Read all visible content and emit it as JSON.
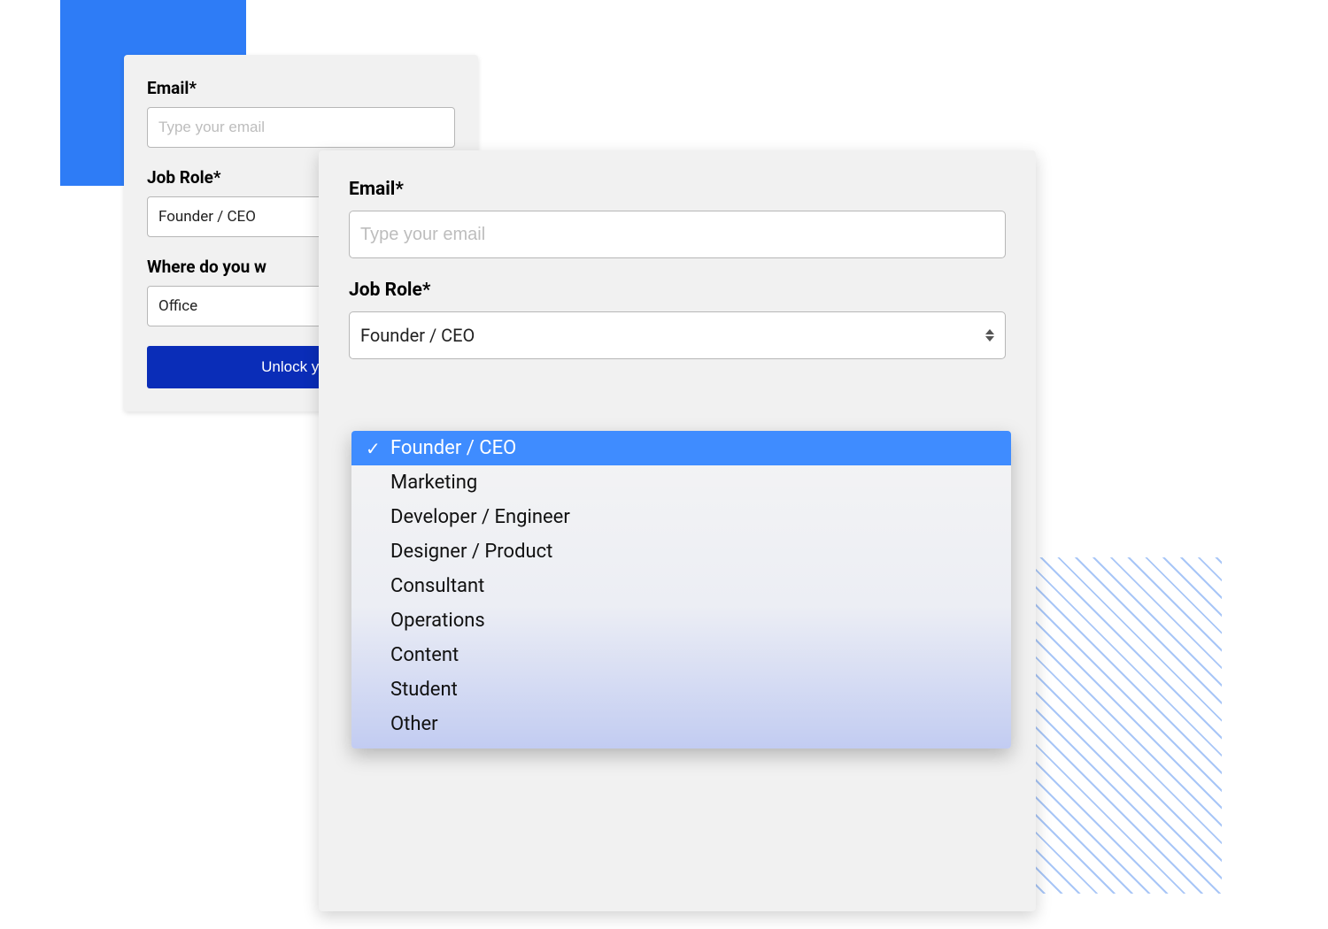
{
  "form_back": {
    "email_label": "Email*",
    "email_placeholder": "Type your email",
    "jobrole_label": "Job Role*",
    "jobrole_value": "Founder / CEO",
    "workplace_label": "Where do you w",
    "workplace_value": "Office",
    "submit_label": "Unlock your"
  },
  "form_front": {
    "email_label": "Email*",
    "email_placeholder": "Type your email",
    "jobrole_label": "Job Role*",
    "jobrole_value": "Founder / CEO"
  },
  "jobrole_options": [
    "Founder / CEO",
    "Marketing",
    "Developer / Engineer",
    "Designer / Product",
    "Consultant",
    "Operations",
    "Content",
    "Student",
    "Other"
  ],
  "jobrole_selected_index": 0,
  "colors": {
    "accent_blue": "#2e7cf6",
    "button_blue": "#0a2db8",
    "option_highlight": "#3f8cff"
  }
}
